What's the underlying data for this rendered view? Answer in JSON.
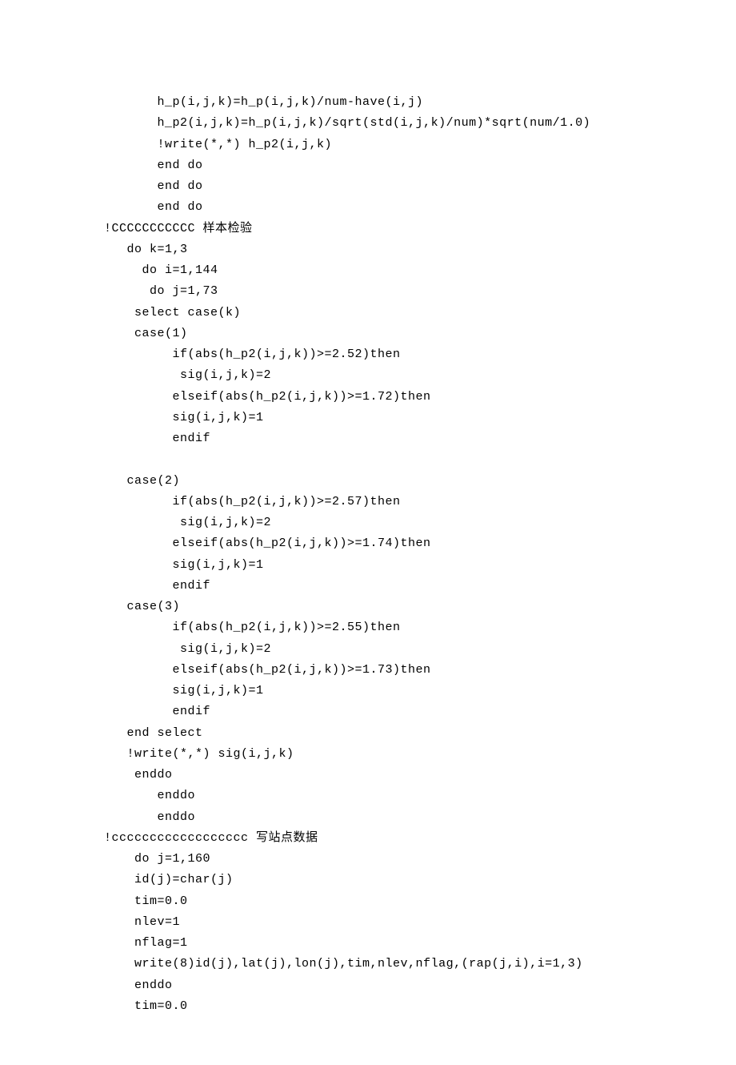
{
  "code": {
    "lines": [
      "       h_p(i,j,k)=h_p(i,j,k)/num-have(i,j)",
      "       h_p2(i,j,k)=h_p(i,j,k)/sqrt(std(i,j,k)/num)*sqrt(num/1.0)",
      "       !write(*,*) h_p2(i,j,k)",
      "       end do",
      "       end do",
      "       end do",
      "!CCCCCCCCCCC 样本检验",
      "   do k=1,3",
      "     do i=1,144",
      "      do j=1,73",
      "    select case(k)",
      "    case(1)",
      "         if(abs(h_p2(i,j,k))>=2.52)then",
      "          sig(i,j,k)=2",
      "         elseif(abs(h_p2(i,j,k))>=1.72)then",
      "         sig(i,j,k)=1",
      "         endif",
      "",
      "   case(2)",
      "         if(abs(h_p2(i,j,k))>=2.57)then",
      "          sig(i,j,k)=2",
      "         elseif(abs(h_p2(i,j,k))>=1.74)then",
      "         sig(i,j,k)=1",
      "         endif",
      "   case(3)",
      "         if(abs(h_p2(i,j,k))>=2.55)then",
      "          sig(i,j,k)=2",
      "         elseif(abs(h_p2(i,j,k))>=1.73)then",
      "         sig(i,j,k)=1",
      "         endif",
      "   end select",
      "   !write(*,*) sig(i,j,k)",
      "    enddo",
      "       enddo",
      "       enddo",
      "!cccccccccccccccccc 写站点数据",
      "    do j=1,160",
      "    id(j)=char(j)",
      "    tim=0.0",
      "    nlev=1",
      "    nflag=1",
      "    write(8)id(j),lat(j),lon(j),tim,nlev,nflag,(rap(j,i),i=1,3)",
      "    enddo",
      "    tim=0.0"
    ]
  }
}
